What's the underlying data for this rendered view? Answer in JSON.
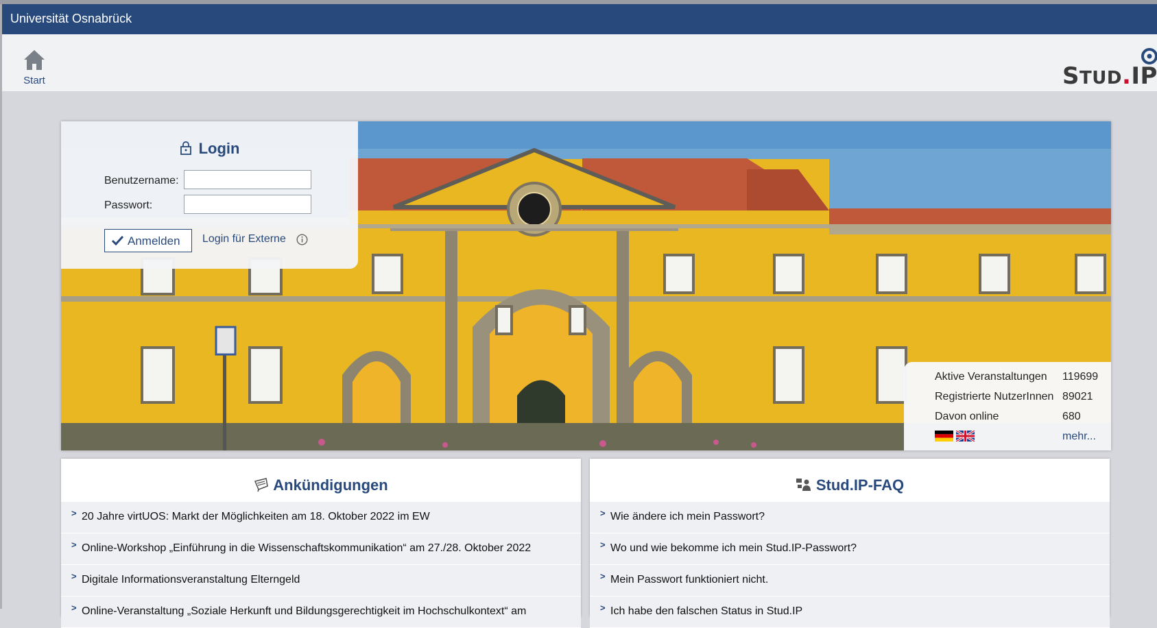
{
  "header": {
    "university": "Universität Osnabrück",
    "start_label": "Start",
    "logo_text": "STUD.IP"
  },
  "login": {
    "title": "Login",
    "username_label": "Benutzername:",
    "password_label": "Passwort:",
    "username_value": "",
    "password_value": "",
    "submit_label": "Anmelden",
    "external_label": "Login für Externe"
  },
  "stats": {
    "rows": [
      {
        "label": "Aktive Veranstaltungen",
        "value": "119699"
      },
      {
        "label": "Registrierte NutzerInnen",
        "value": "89021"
      },
      {
        "label": "Davon online",
        "value": "680"
      }
    ],
    "more_label": "mehr..."
  },
  "announcements": {
    "title": "Ankündigungen",
    "items": [
      "20 Jahre virtUOS: Markt der Möglichkeiten am 18. Oktober 2022 im EW",
      "Online-Workshop „Einführung in die Wissenschaftskommunikation“ am 27./28. Oktober 2022",
      "Digitale Informationsveranstaltung Elterngeld",
      "Online-Veranstaltung „Soziale Herkunft und Bildungsgerechtigkeit im Hochschulkontext“ am"
    ]
  },
  "faq": {
    "title": "Stud.IP-FAQ",
    "items": [
      "Wie ändere ich mein Passwort?",
      "Wo und wie bekomme ich mein Stud.IP-Passwort?",
      "Mein Passwort funktioniert nicht.",
      "Ich habe den falschen Status in Stud.IP"
    ]
  },
  "colors": {
    "brand": "#28497c",
    "facade": "#e9b722",
    "roof": "#c0583a",
    "sky": "#6ea5d3"
  },
  "icons": [
    "home-icon",
    "lock-icon",
    "check-icon",
    "info-icon",
    "announcement-icon",
    "faq-icon",
    "chevron-right-icon",
    "german-flag-icon",
    "english-flag-icon"
  ]
}
